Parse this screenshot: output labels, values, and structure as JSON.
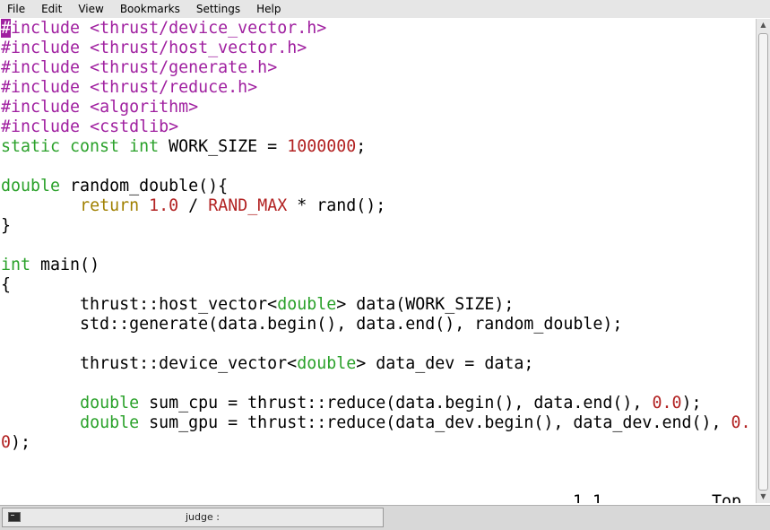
{
  "menubar": {
    "items": [
      "File",
      "Edit",
      "View",
      "Bookmarks",
      "Settings",
      "Help"
    ]
  },
  "editor": {
    "lines": [
      [
        {
          "t": "#",
          "c": "cur"
        },
        {
          "t": "include",
          "c": "pre"
        },
        {
          "t": " "
        },
        {
          "t": "<thrust/device_vector.h>",
          "c": "pre"
        }
      ],
      [
        {
          "t": "#include",
          "c": "pre"
        },
        {
          "t": " "
        },
        {
          "t": "<thrust/host_vector.h>",
          "c": "pre"
        }
      ],
      [
        {
          "t": "#include",
          "c": "pre"
        },
        {
          "t": " "
        },
        {
          "t": "<thrust/generate.h>",
          "c": "pre"
        }
      ],
      [
        {
          "t": "#include",
          "c": "pre"
        },
        {
          "t": " "
        },
        {
          "t": "<thrust/reduce.h>",
          "c": "pre"
        }
      ],
      [
        {
          "t": "#include",
          "c": "pre"
        },
        {
          "t": " "
        },
        {
          "t": "<algorithm>",
          "c": "pre"
        }
      ],
      [
        {
          "t": "#include",
          "c": "pre"
        },
        {
          "t": " "
        },
        {
          "t": "<cstdlib>",
          "c": "pre"
        }
      ],
      [
        {
          "t": "static const int",
          "c": "kw"
        },
        {
          "t": " WORK_SIZE = "
        },
        {
          "t": "1000000",
          "c": "num"
        },
        {
          "t": ";"
        }
      ],
      [],
      [
        {
          "t": "double",
          "c": "kw"
        },
        {
          "t": " random_double(){"
        }
      ],
      [
        {
          "t": "        "
        },
        {
          "t": "return",
          "c": "ret"
        },
        {
          "t": " "
        },
        {
          "t": "1.0",
          "c": "num"
        },
        {
          "t": " / "
        },
        {
          "t": "RAND_MAX",
          "c": "num"
        },
        {
          "t": " * rand();"
        }
      ],
      [
        {
          "t": "}"
        }
      ],
      [],
      [
        {
          "t": "int",
          "c": "kw"
        },
        {
          "t": " main()"
        }
      ],
      [
        {
          "t": "{"
        }
      ],
      [
        {
          "t": "        thrust::host_vector<"
        },
        {
          "t": "double",
          "c": "kw"
        },
        {
          "t": "> data(WORK_SIZE);"
        }
      ],
      [
        {
          "t": "        std::generate(data.begin(), data.end(), random_double);"
        }
      ],
      [],
      [
        {
          "t": "        thrust::device_vector<"
        },
        {
          "t": "double",
          "c": "kw"
        },
        {
          "t": "> data_dev = data;"
        }
      ],
      [],
      [
        {
          "t": "        "
        },
        {
          "t": "double",
          "c": "kw"
        },
        {
          "t": " sum_cpu = thrust::reduce(data.begin(), data.end(), "
        },
        {
          "t": "0.0",
          "c": "num"
        },
        {
          "t": ");"
        }
      ],
      [
        {
          "t": "        "
        },
        {
          "t": "double",
          "c": "kw"
        },
        {
          "t": " sum_gpu = thrust::reduce(data_dev.begin(), data_dev.end(), "
        },
        {
          "t": "0.",
          "c": "num"
        }
      ],
      [
        {
          "t": "0",
          "c": "num"
        },
        {
          "t": ");"
        }
      ]
    ],
    "cursor_position": "1,1",
    "scroll_indicator": "Top"
  },
  "taskbar": {
    "task_label": "judge :",
    "task_icon": "terminal-icon"
  },
  "colors": {
    "preprocessor": "#a020a0",
    "keyword": "#2aa12a",
    "return_keyword": "#a08000",
    "number": "#b22222"
  }
}
